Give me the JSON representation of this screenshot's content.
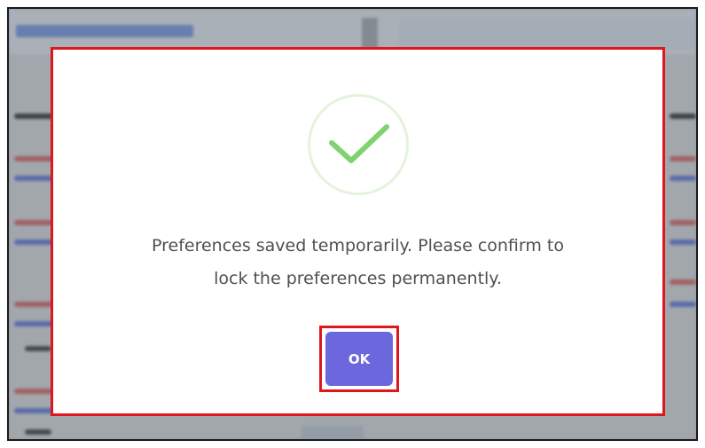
{
  "dialog": {
    "icon": "check-icon",
    "message_line1": "Preferences saved temporarily. Please confirm to",
    "message_line2": "lock the preferences permanently.",
    "ok_label": "OK"
  },
  "colors": {
    "highlight_border": "#e0161e",
    "ok_button": "#6d67de",
    "check_stroke": "#7ed36e",
    "check_ring": "#e4f3dc",
    "message_text": "#4f4f4f"
  }
}
